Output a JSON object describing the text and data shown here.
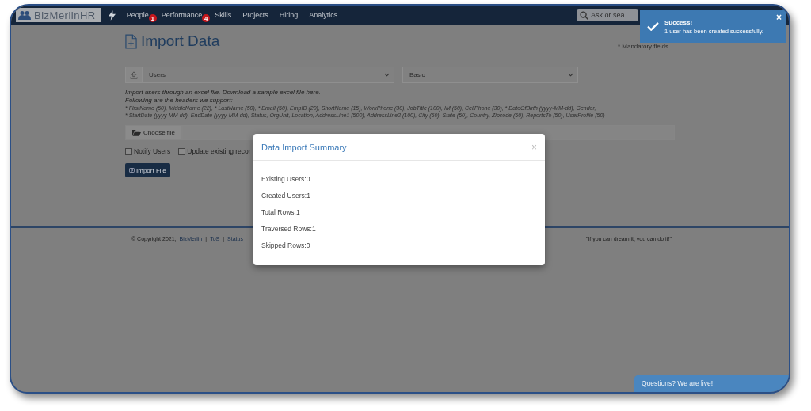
{
  "navbar": {
    "logo": "BizMerlinHR",
    "menu": [
      {
        "label": "People",
        "badge": "1"
      },
      {
        "label": "Performance",
        "badge": "4"
      },
      {
        "label": "Skills"
      },
      {
        "label": "Projects"
      },
      {
        "label": "Hiring"
      },
      {
        "label": "Analytics"
      }
    ],
    "search": {
      "placeholder": "Ask or sea"
    }
  },
  "page": {
    "title": "Import Data",
    "mandatory_note": "* Mandatory fields",
    "type_select": {
      "value": "Users"
    },
    "template_select": {
      "value": "Basic"
    },
    "intro": "Import users through an excel file. Download a sample excel file",
    "intro_link": "here.",
    "headers_title": "Following are the headers we support:",
    "headers": [
      "* FirstName (50), MiddleName (22), * LastName (50), * Email (50), EmpID (20), ShortName (15), WorkPhone (30), JobTitle (100), IM (50), CellPhone (30), * DateOfBirth (yyyy-MM-dd), Gender,",
      "* StartDate (yyyy-MM-dd), EndDate (yyyy-MM-dd), Status, OrgUnit, Location, AddressLine1 (500), AddressLine2 (100), City (50), State (50), Country, Zipcode (50), ReportsTo (50), UserProfile (50)"
    ],
    "file_button": "Choose file",
    "options": [
      {
        "label": "Notify Users",
        "checked": false
      },
      {
        "label": "Update existing recor",
        "checked": false
      }
    ],
    "import_button": "Import File"
  },
  "footer": {
    "copyright": "© Copyright 2021,",
    "company": "BizMerlin",
    "separator": "|",
    "links": [
      "ToS",
      "Status"
    ],
    "quote": "\"If you can dream it, you can do it!\""
  },
  "modal": {
    "title": "Data Import Summary",
    "close": "×",
    "stats": [
      "Existing Users:0",
      "Created Users:1",
      "Total Rows:1",
      "Traversed Rows:1",
      "Skipped Rows:0"
    ]
  },
  "toast": {
    "title": "Success!",
    "message": "1 user has been created successfully.",
    "close": "×"
  },
  "chat": {
    "label": "Questions? We are live!"
  }
}
